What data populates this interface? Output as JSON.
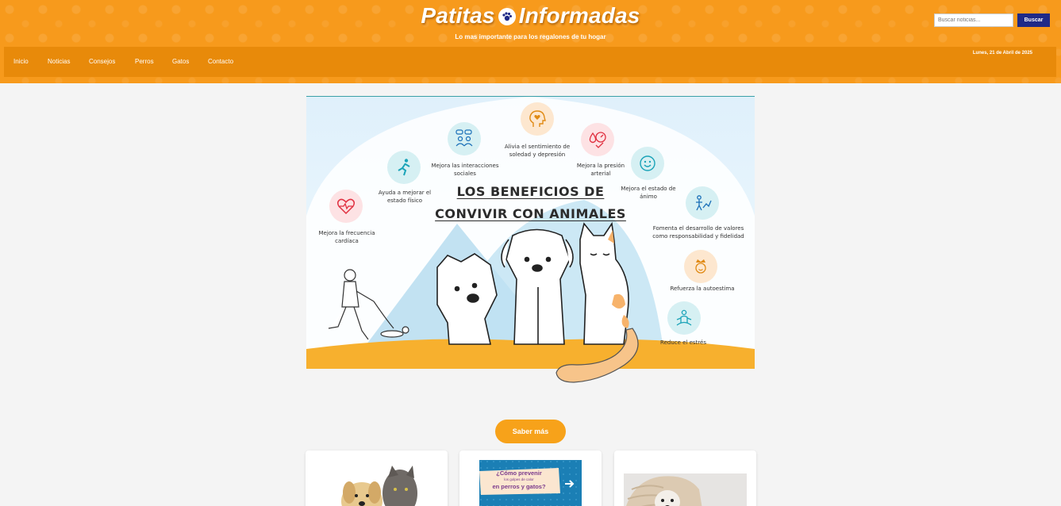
{
  "site": {
    "title_part1": "Patitas",
    "title_part2": "Informadas",
    "tagline": "Lo mas importante para los regalones de tu hogar",
    "date": "Lunes, 21 de Abril de 2025"
  },
  "nav": {
    "items": [
      {
        "label": "Inicio"
      },
      {
        "label": "Noticias"
      },
      {
        "label": "Consejos"
      },
      {
        "label": "Perros"
      },
      {
        "label": "Gatos"
      },
      {
        "label": "Contacto"
      }
    ]
  },
  "search": {
    "placeholder": "Buscar noticias...",
    "button_label": "Buscar"
  },
  "hero": {
    "title_line1": "LOS BENEFICIOS DE",
    "title_line2": "CONVIVIR CON ANIMALES",
    "benefits": [
      {
        "text": "Mejora la frecuencia cardíaca",
        "icon": "heart-pulse-icon"
      },
      {
        "text": "Ayuda a mejorar el estado físico",
        "icon": "runner-icon"
      },
      {
        "text": "Mejora las interacciones sociales",
        "icon": "people-chat-icon"
      },
      {
        "text": "Alivia el sentimiento de soledad y depresión",
        "icon": "head-heart-icon"
      },
      {
        "text": "Mejora la presión arterial",
        "icon": "blood-pressure-icon"
      },
      {
        "text": "Mejora el estado de ánimo",
        "icon": "smiley-icon"
      },
      {
        "text": "Fomenta el desarrollo de valores como responsabilidad y fidelidad",
        "icon": "values-icon"
      },
      {
        "text": "Refuerza la autoestima",
        "icon": "crown-icon"
      },
      {
        "text": "Reduce el estrés",
        "icon": "meditation-icon"
      }
    ]
  },
  "cta": {
    "label": "Saber más"
  },
  "cards": [
    {
      "image": "puppy-and-kitten-photo"
    },
    {
      "image": "heat-stroke-prevention-graphic",
      "caption_line1": "¿Cómo prevenir",
      "caption_line2": "los golpes de calor",
      "caption_line3": "en perros y gatos?"
    },
    {
      "image": "dog-in-blanket-photo"
    }
  ],
  "colors": {
    "header_orange": "#f79a1c",
    "nav_orange": "#e88a0a",
    "search_button_navy": "#1f2a87",
    "cta_orange": "#f7a21a"
  }
}
